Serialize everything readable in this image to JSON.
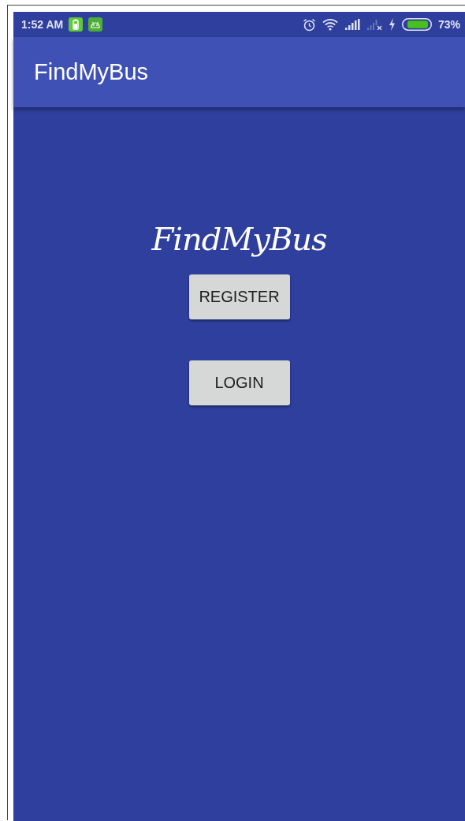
{
  "status_bar": {
    "time": "1:52 AM",
    "battery_percent": "73%"
  },
  "app_bar": {
    "title": "FindMyBus"
  },
  "logo": {
    "text": "FindMyBus"
  },
  "buttons": [
    {
      "label": "REGISTER"
    },
    {
      "label": "LOGIN"
    }
  ]
}
